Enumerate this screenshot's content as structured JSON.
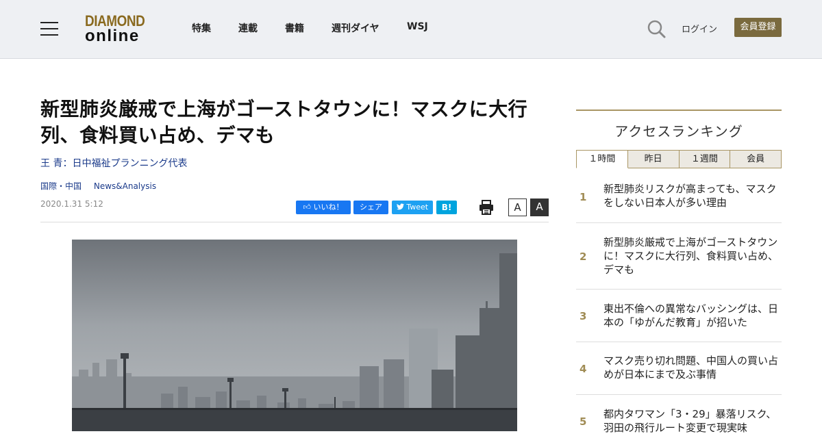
{
  "header": {
    "logo_line1": "DIAMOND",
    "logo_line2": "online",
    "nav": [
      "特集",
      "連載",
      "書籍",
      "週刊ダイヤ",
      "WSJ"
    ],
    "login_label": "ログイン",
    "register_label": "会員登録",
    "icons": [
      "hamburger-menu-icon",
      "search-icon"
    ]
  },
  "article": {
    "title": "新型肺炎厳戒で上海がゴーストタウンに！マスクに大行列、食料買い占め、デマも",
    "author": "王 青：日中福祉プランニング代表",
    "categories": [
      "国際・中国",
      "News&Analysis"
    ],
    "date": "2020.1.31 5:12",
    "share": {
      "like": "いいね！",
      "share": "シェア",
      "tweet": "Tweet",
      "hatena": "B!"
    },
    "font_small": "A",
    "font_large": "A"
  },
  "sidebar": {
    "title": "アクセスランキング",
    "tabs": [
      "１時間",
      "昨日",
      "１週間",
      "会員"
    ],
    "active_tab": "１時間",
    "ranking": [
      {
        "rank": "1",
        "text": "新型肺炎リスクが高まっても、マスクをしない日本人が多い理由"
      },
      {
        "rank": "2",
        "text": "新型肺炎厳戒で上海がゴーストタウンに！マスクに大行列、食料買い占め、デマも"
      },
      {
        "rank": "3",
        "text": "東出不倫への異常なバッシングは、日本の「ゆがんだ教育」が招いた"
      },
      {
        "rank": "4",
        "text": "マスク売り切れ問題、中国人の買い占めが日本にまで及ぶ事情"
      },
      {
        "rank": "5",
        "text": "都内タワマン「3・29」暴落リスク、羽田の飛行ルート変更で現実味"
      }
    ]
  },
  "colors": {
    "logo_gold": "#8a6a1f",
    "register_button": "#7a6a3e",
    "rank_number": "#a08c55",
    "link_blue": "#1a3a8a",
    "facebook": "#1877f2",
    "twitter": "#1da1f2",
    "hatena": "#00a4de"
  }
}
